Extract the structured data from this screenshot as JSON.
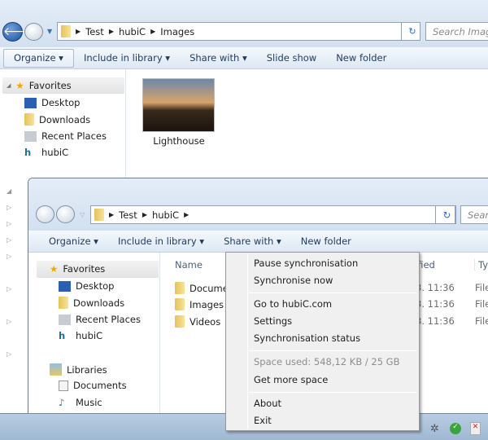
{
  "back_window": {
    "breadcrumb": [
      "Test",
      "hubiC",
      "Images"
    ],
    "search_placeholder": "Search Images",
    "toolbar": {
      "organize": "Organize",
      "include": "Include in library",
      "share": "Share with",
      "slideshow": "Slide show",
      "newfolder": "New folder"
    },
    "nav": {
      "favorites": "Favorites",
      "items": [
        "Desktop",
        "Downloads",
        "Recent Places",
        "hubiC"
      ]
    },
    "files": [
      {
        "name": "Lighthouse"
      }
    ]
  },
  "front_window": {
    "breadcrumb": [
      "Test",
      "hubiC"
    ],
    "search_placeholder": "Search",
    "toolbar": {
      "organize": "Organize",
      "include": "Include in library",
      "share": "Share with",
      "newfolder": "New folder"
    },
    "nav": {
      "favorites": "Favorites",
      "fav_items": [
        "Desktop",
        "Downloads",
        "Recent Places",
        "hubiC"
      ],
      "libraries": "Libraries",
      "lib_items": [
        "Documents",
        "Music"
      ]
    },
    "columns": {
      "name": "Name",
      "modified": "ified",
      "type": "Typ"
    },
    "rows": [
      {
        "name": "Docume",
        "modified": "3. 11:36",
        "type": "File"
      },
      {
        "name": "Images",
        "modified": "3. 11:36",
        "type": "File"
      },
      {
        "name": "Videos",
        "modified": "3. 11:36",
        "type": "File"
      }
    ]
  },
  "context_menu": {
    "items": [
      "Pause synchronisation",
      "Synchronise now",
      "Go to hubiC.com",
      "Settings",
      "Synchronisation status",
      "Space used: 548,12 KB / 25 GB",
      "Get more space",
      "About",
      "Exit"
    ]
  }
}
